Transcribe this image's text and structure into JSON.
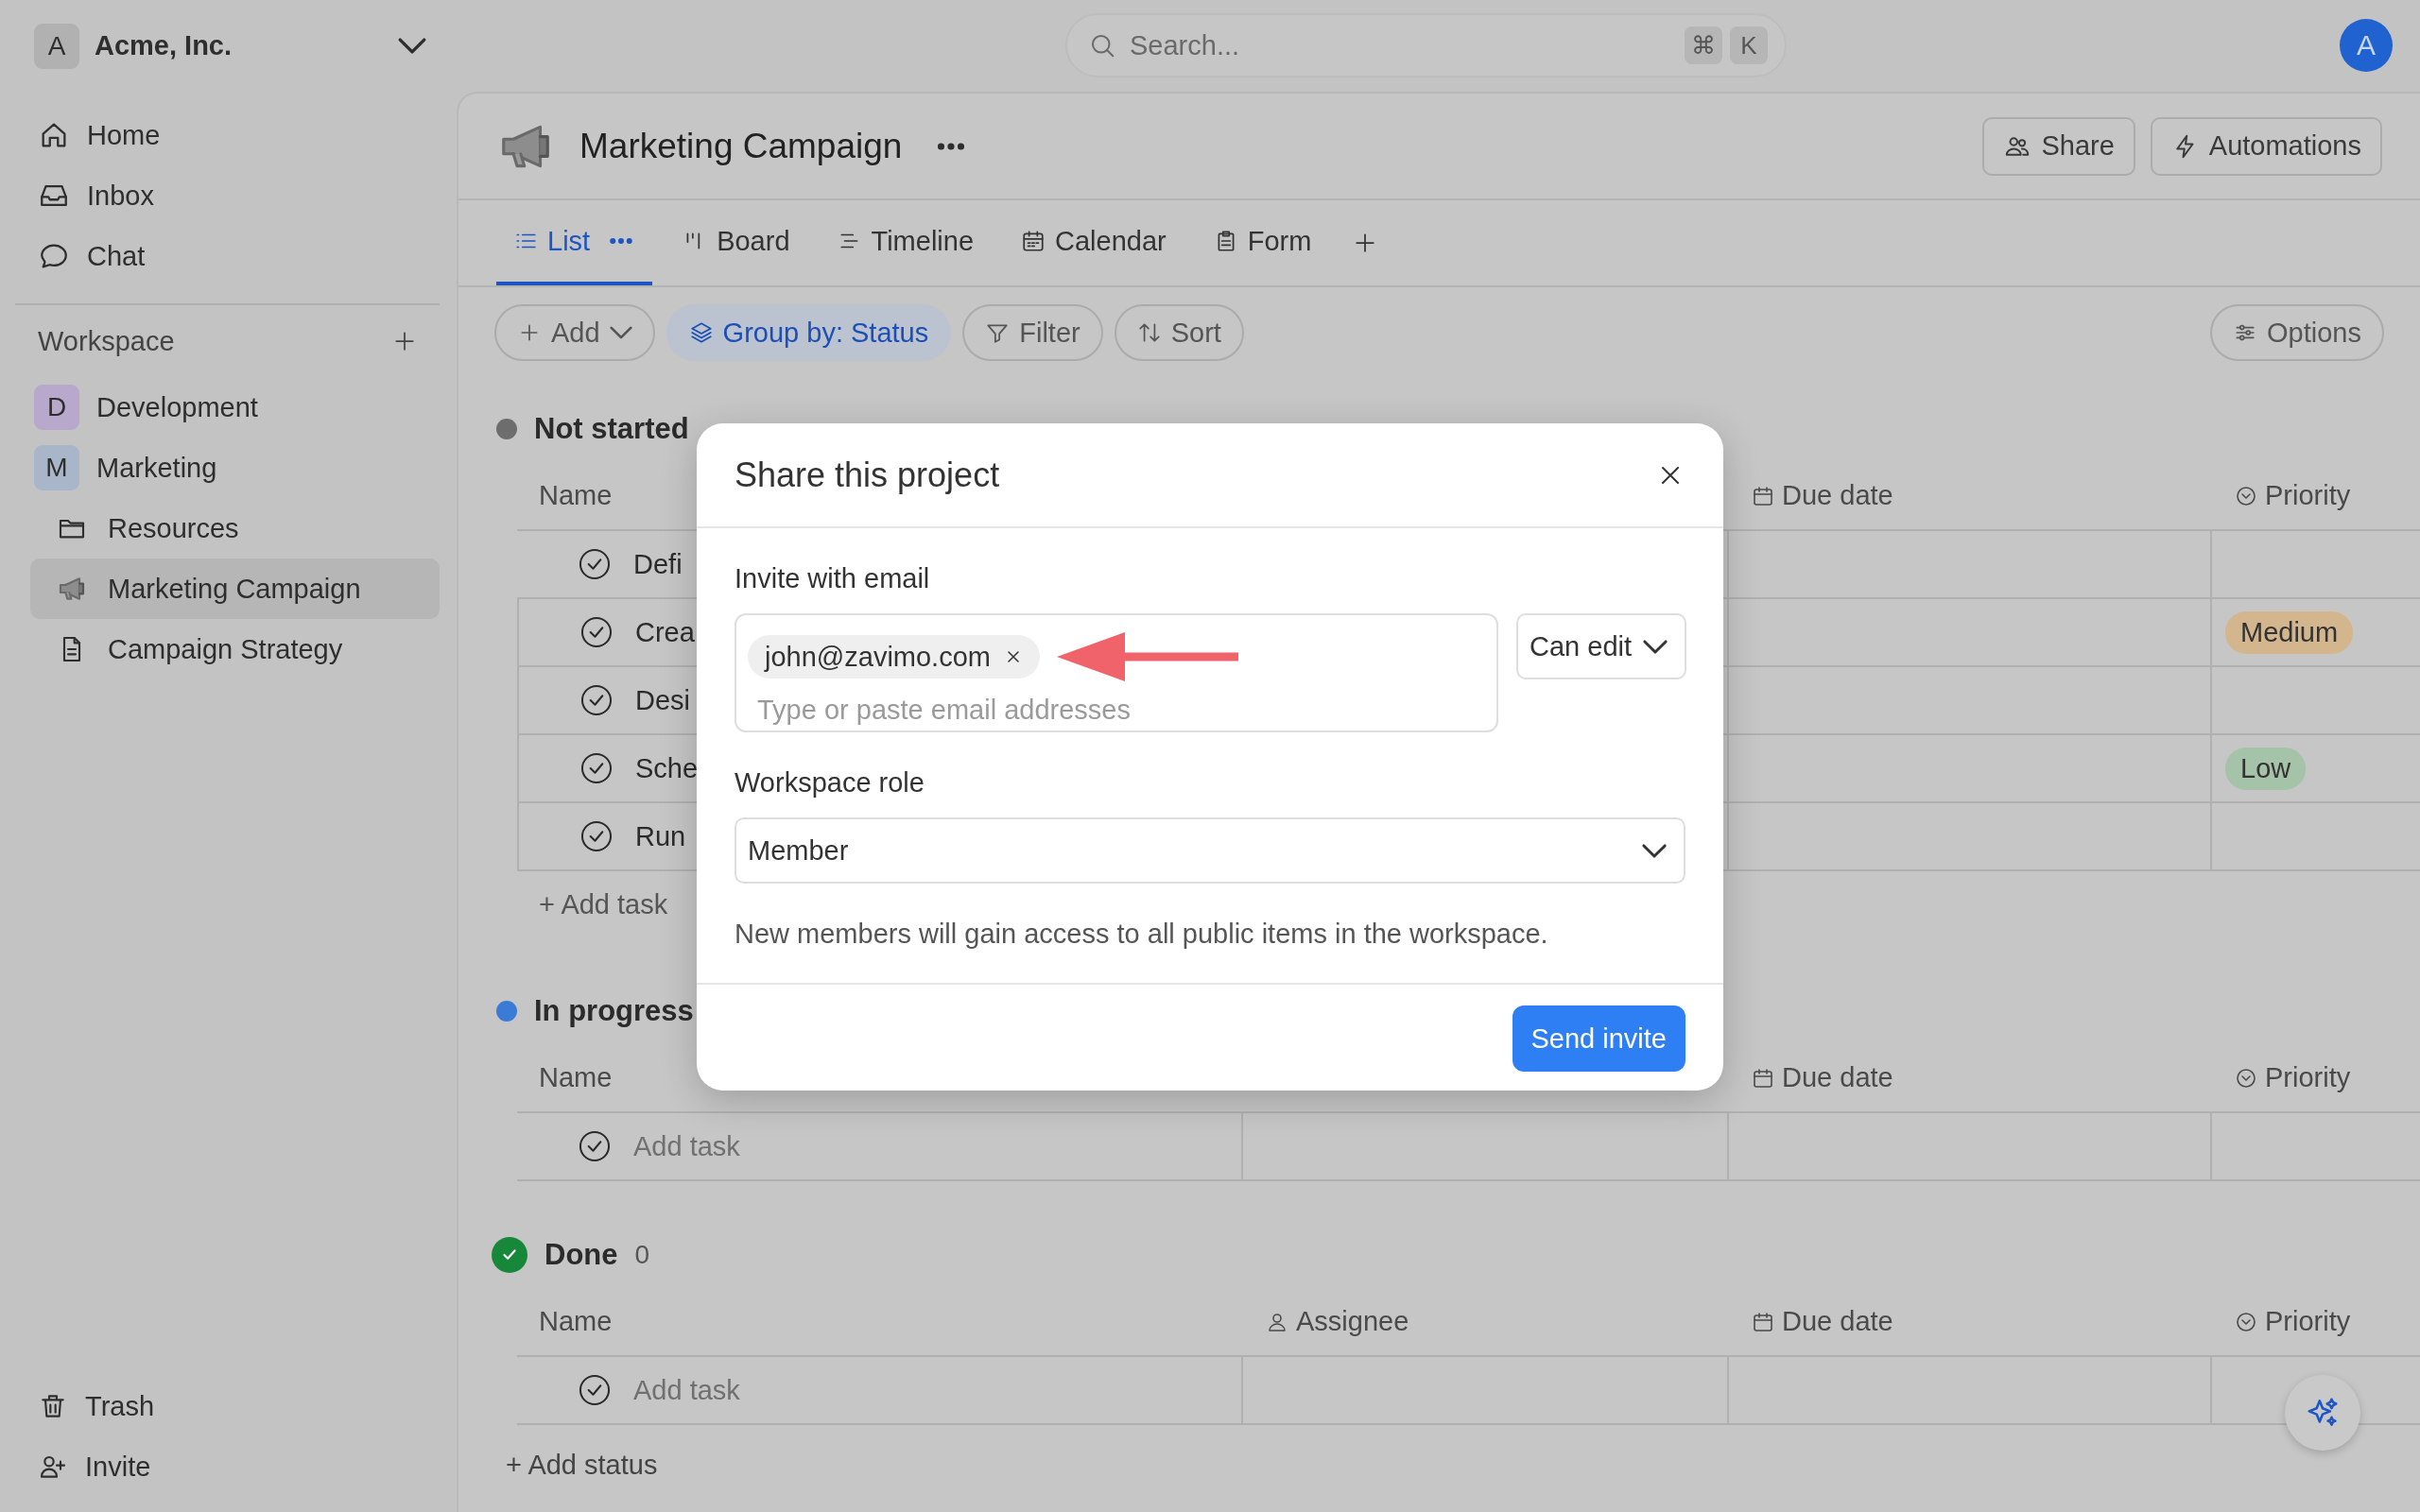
{
  "workspace_switcher": {
    "initial": "A",
    "name": "Acme, Inc."
  },
  "search": {
    "placeholder": "Search...",
    "shortcut": [
      "⌘",
      "K"
    ]
  },
  "user_avatar": {
    "initial": "A"
  },
  "sidebar": {
    "nav": [
      {
        "kind": "home",
        "label": "Home"
      },
      {
        "kind": "inbox",
        "label": "Inbox"
      },
      {
        "kind": "chat",
        "label": "Chat"
      }
    ],
    "workspace_title": "Workspace",
    "teams": [
      {
        "initial": "D",
        "label": "Development",
        "color": "#b8a8cb"
      },
      {
        "initial": "M",
        "label": "Marketing",
        "color": "#a9b6ca",
        "children": [
          {
            "kind": "folder",
            "label": "Resources",
            "selected": false
          },
          {
            "kind": "megaphone",
            "label": "Marketing Campaign",
            "selected": true
          },
          {
            "kind": "document",
            "label": "Campaign Strategy",
            "selected": false
          }
        ]
      }
    ],
    "footer": [
      {
        "kind": "trash",
        "label": "Trash"
      },
      {
        "kind": "invite",
        "label": "Invite"
      }
    ]
  },
  "project": {
    "title": "Marketing Campaign",
    "actions": [
      {
        "kind": "share",
        "label": "Share"
      },
      {
        "kind": "automations",
        "label": "Automations"
      }
    ]
  },
  "views": [
    {
      "kind": "list",
      "label": "List",
      "selected": true
    },
    {
      "kind": "board",
      "label": "Board",
      "selected": false
    },
    {
      "kind": "timeline",
      "label": "Timeline",
      "selected": false
    },
    {
      "kind": "calendar",
      "label": "Calendar",
      "selected": false
    },
    {
      "kind": "form",
      "label": "Form",
      "selected": false
    }
  ],
  "toolbar": [
    {
      "kind": "add",
      "label": "Add",
      "selected": false
    },
    {
      "kind": "group",
      "label": "Group by: Status",
      "selected": true
    },
    {
      "kind": "filter",
      "label": "Filter",
      "selected": false
    },
    {
      "kind": "sort",
      "label": "Sort",
      "selected": false
    }
  ],
  "options_label": "Options",
  "groups": [
    {
      "kind": "dot",
      "title": "Not started",
      "color": "#6d6d6d",
      "columns": [
        {
          "kind": "name",
          "label": "Name"
        },
        {
          "kind": "due",
          "label": "Due date"
        },
        {
          "kind": "priority",
          "label": "Priority"
        }
      ],
      "rows": [
        {
          "kind": "task",
          "name": "Defi"
        },
        {
          "kind": "task",
          "name": "Crea",
          "priority": {
            "label": "Medium",
            "color": "#d4b68e"
          }
        },
        {
          "kind": "task",
          "name": "Desi"
        },
        {
          "kind": "task",
          "name": "Sche",
          "priority": {
            "label": "Low",
            "color": "#a5c3a8"
          }
        },
        {
          "kind": "task",
          "name": "Run"
        }
      ],
      "add_task": "+ Add task"
    },
    {
      "kind": "dot",
      "title": "In progress",
      "color": "#3b7bd8",
      "columns": [
        {
          "kind": "name",
          "label": "Name"
        },
        {
          "kind": "due",
          "label": "Due date"
        },
        {
          "kind": "priority",
          "label": "Priority"
        }
      ],
      "rows": [
        {
          "kind": "placeholder",
          "name": "Add task"
        }
      ]
    },
    {
      "kind": "check",
      "title": "Done",
      "count": "0",
      "color": "#17883a",
      "columns": [
        {
          "kind": "name",
          "label": "Name"
        },
        {
          "kind": "assignee",
          "label": "Assignee"
        },
        {
          "kind": "due",
          "label": "Due date"
        },
        {
          "kind": "priority",
          "label": "Priority"
        }
      ],
      "rows": [
        {
          "kind": "placeholder",
          "name": "Add task"
        }
      ]
    }
  ],
  "add_status": "+ Add status",
  "dialog": {
    "title": "Share this project",
    "invite_label": "Invite with email",
    "emails": [
      "john@zavimo.com"
    ],
    "email_placeholder": "Type or paste email addresses",
    "permission": "Can edit",
    "role_label": "Workspace role",
    "role": "Member",
    "note": "New members will gain access to all public items in the workspace.",
    "submit": "Send invite"
  }
}
